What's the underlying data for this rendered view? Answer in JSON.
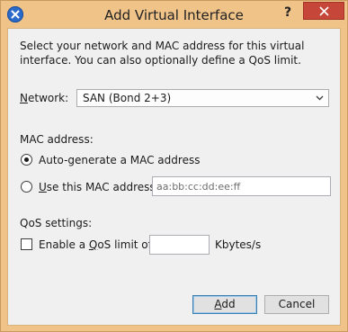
{
  "window": {
    "title": "Add Virtual Interface",
    "help_label": "?",
    "close_icon": "close-icon",
    "app_icon": "close-circle-icon"
  },
  "intro": {
    "text": "Select your network and MAC address for this virtual interface. You can also optionally define a QoS limit."
  },
  "network": {
    "label_prefix": "",
    "label_mnemonic": "N",
    "label_rest": "etwork:",
    "selected": "SAN (Bond 2+3)"
  },
  "mac": {
    "section_label": "MAC address:",
    "auto_label": "Auto-generate a MAC address",
    "auto_checked": true,
    "use_mnemonic": "U",
    "use_rest": "se this MAC address:",
    "use_checked": false,
    "input_placeholder": "aa:bb:cc:dd:ee:ff",
    "input_value": ""
  },
  "qos": {
    "section_label": "QoS settings:",
    "enable_prefix": "Enable a ",
    "enable_mnemonic": "Q",
    "enable_rest": "oS limit of:",
    "enable_checked": false,
    "limit_value": "",
    "unit": "Kbytes/s"
  },
  "buttons": {
    "add_mnemonic": "A",
    "add_rest": "dd",
    "cancel_label": "Cancel"
  },
  "colors": {
    "frame": "#f0c389",
    "close_button": "#c7463a",
    "client_bg": "#f0f0f0"
  }
}
